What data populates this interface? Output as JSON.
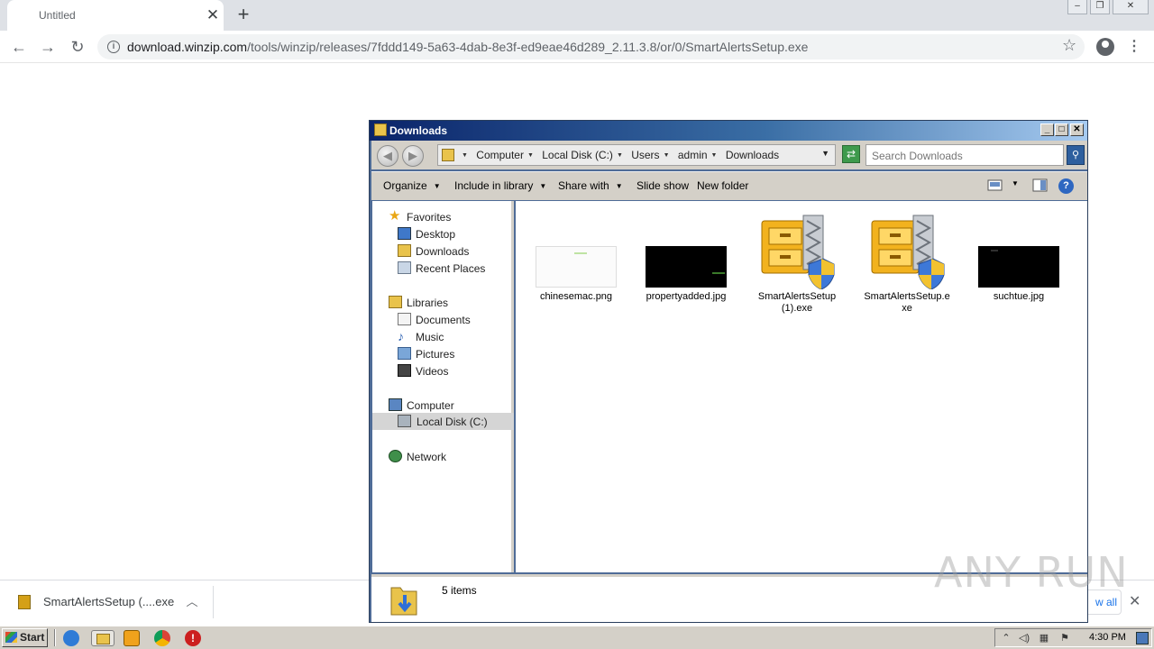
{
  "browser": {
    "tab_title": "Untitled",
    "url_host": "download.winzip.com",
    "url_path": "/tools/winzip/releases/7fddd149-5a63-4dab-8e3f-ed9eae46d289_2.11.3.8/or/0/SmartAlertsSetup.exe"
  },
  "download_bar": {
    "item_name": "SmartAlertsSetup (....exe",
    "show_all": "w all"
  },
  "explorer": {
    "title": "Downloads",
    "breadcrumbs": [
      "Computer",
      "Local Disk (C:)",
      "Users",
      "admin",
      "Downloads"
    ],
    "search_placeholder": "Search Downloads",
    "commands": {
      "organize": "Organize",
      "include_in_library": "Include in library",
      "share_with": "Share with",
      "slide_show": "Slide show",
      "new_folder": "New folder"
    },
    "nav": {
      "favorites": "Favorites",
      "desktop": "Desktop",
      "downloads": "Downloads",
      "recent_places": "Recent Places",
      "libraries": "Libraries",
      "documents": "Documents",
      "music": "Music",
      "pictures": "Pictures",
      "videos": "Videos",
      "computer": "Computer",
      "local_disk": "Local Disk (C:)",
      "network": "Network"
    },
    "files": [
      {
        "name": "chinesemac.png",
        "kind": "image-light"
      },
      {
        "name": "propertyadded.jpg",
        "kind": "image-dark"
      },
      {
        "name_line1": "SmartAlertsSetup",
        "name_line2": "(1).exe",
        "kind": "winzip-installer-icon"
      },
      {
        "name_line1": "SmartAlertsSetup.e",
        "name_line2": "xe",
        "kind": "winzip-installer-icon"
      },
      {
        "name": "suchtue.jpg",
        "kind": "image-dark"
      }
    ],
    "status": "5 items"
  },
  "watermark": "ANY RUN",
  "taskbar": {
    "start_label": "Start",
    "clock": "4:30 PM"
  },
  "colors": {
    "explorer_title_start": "#0a246a",
    "explorer_title_end": "#a6caf0",
    "taskbar": "#d4d0c8",
    "chrome_tabstrip": "#dee1e6"
  }
}
